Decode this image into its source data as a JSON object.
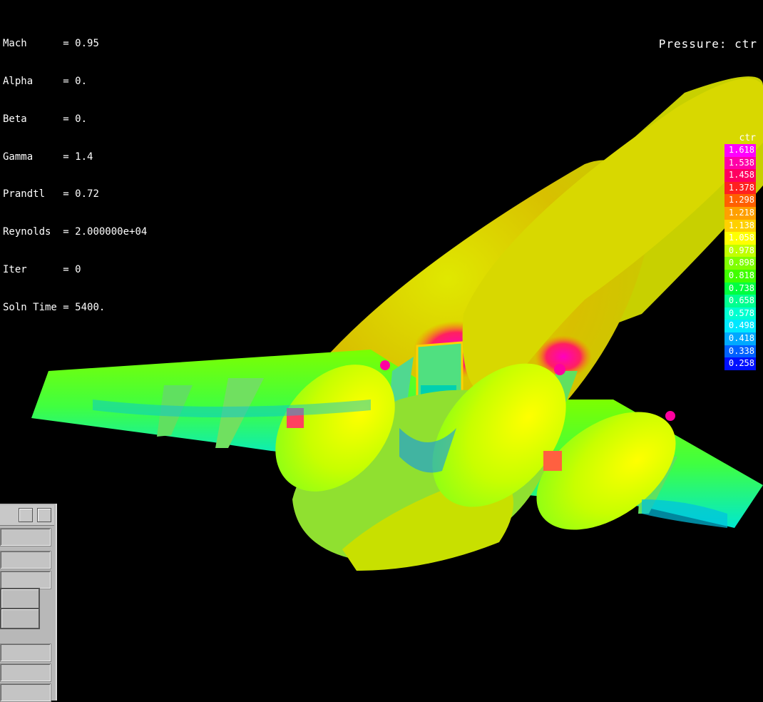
{
  "window": {
    "params": [
      {
        "label": "Mach",
        "value": "0.95"
      },
      {
        "label": "Alpha",
        "value": "0."
      },
      {
        "label": "Beta",
        "value": "0."
      },
      {
        "label": "Gamma",
        "value": "1.4"
      },
      {
        "label": "Prandtl",
        "value": "0.72"
      },
      {
        "label": "Reynolds",
        "value": "2.000000e+04"
      },
      {
        "label": "Iter",
        "value": "0"
      },
      {
        "label": "Soln Time",
        "value": "5400."
      }
    ],
    "title": "Pressure: ctr"
  },
  "legend": {
    "title": "ctr",
    "levels": [
      {
        "value": "1.618",
        "color": "#ff00ff"
      },
      {
        "value": "1.538",
        "color": "#ff00a8"
      },
      {
        "value": "1.458",
        "color": "#ff0060"
      },
      {
        "value": "1.378",
        "color": "#ff2020"
      },
      {
        "value": "1.298",
        "color": "#ff6000"
      },
      {
        "value": "1.218",
        "color": "#ffa000"
      },
      {
        "value": "1.138",
        "color": "#ffd000"
      },
      {
        "value": "1.058",
        "color": "#ffff00"
      },
      {
        "value": "0.978",
        "color": "#c0ff00"
      },
      {
        "value": "0.898",
        "color": "#80ff00"
      },
      {
        "value": "0.818",
        "color": "#40ff00"
      },
      {
        "value": "0.738",
        "color": "#00ff40"
      },
      {
        "value": "0.658",
        "color": "#00ff90"
      },
      {
        "value": "0.578",
        "color": "#00ffd0"
      },
      {
        "value": "0.498",
        "color": "#00e8ff"
      },
      {
        "value": "0.418",
        "color": "#00a8ff"
      },
      {
        "value": "0.338",
        "color": "#0060ff"
      },
      {
        "value": "0.258",
        "color": "#0010ff"
      }
    ]
  }
}
